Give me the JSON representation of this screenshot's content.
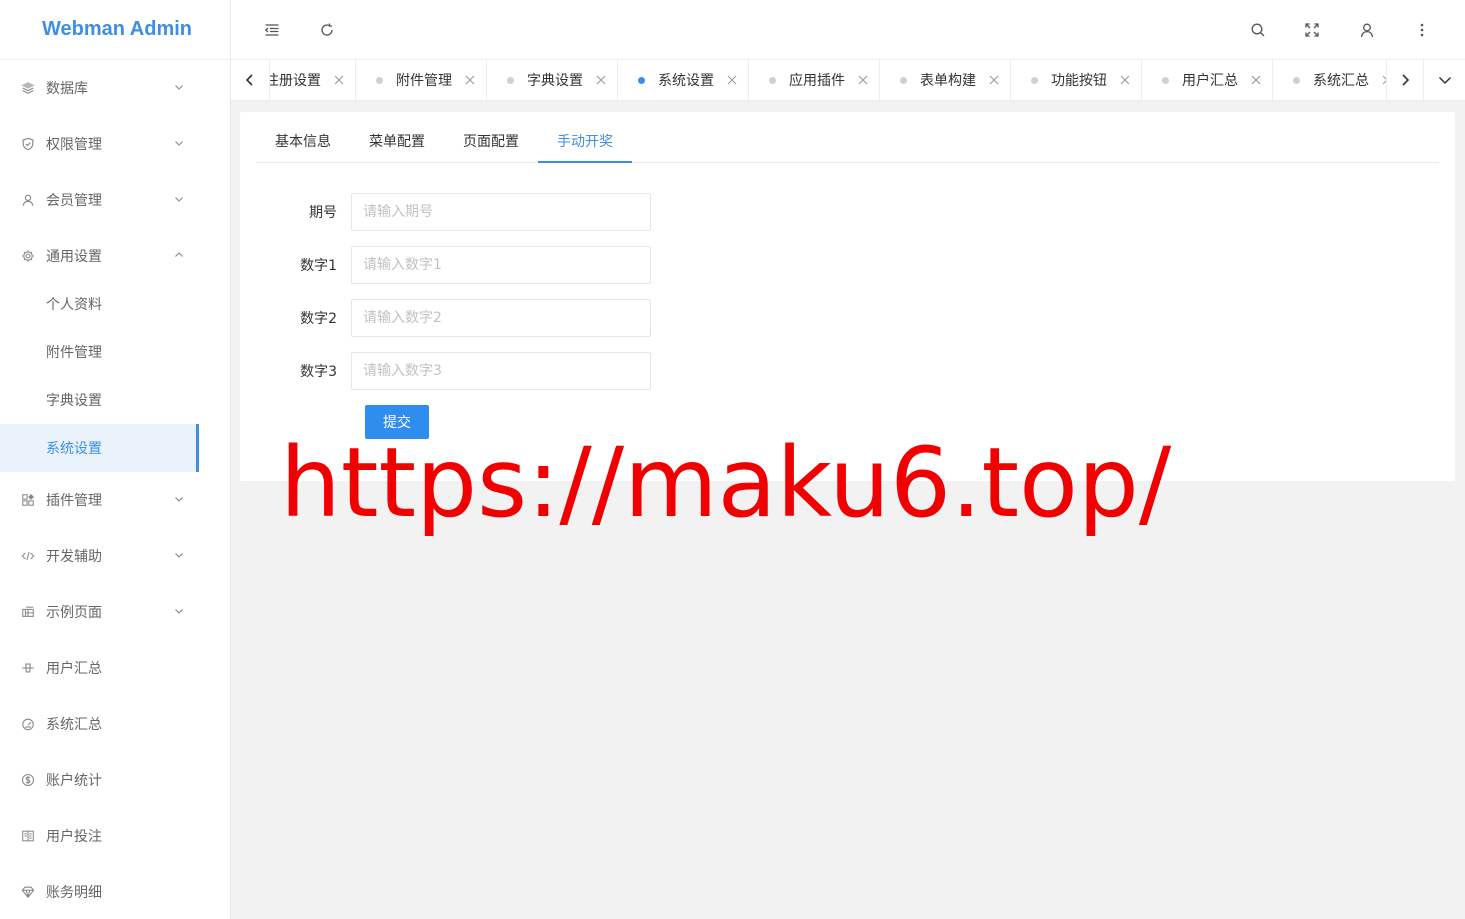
{
  "app": {
    "logo_text": "Webman Admin"
  },
  "sidebar": {
    "items": [
      {
        "label": "数据库",
        "icon": "layers-icon",
        "expandable": true
      },
      {
        "label": "权限管理",
        "icon": "shield-icon",
        "expandable": true
      },
      {
        "label": "会员管理",
        "icon": "user-icon",
        "expandable": true
      },
      {
        "label": "通用设置",
        "icon": "gear-icon",
        "expandable": true,
        "expanded": true
      },
      {
        "label": "插件管理",
        "icon": "apps-icon",
        "expandable": true
      },
      {
        "label": "开发辅助",
        "icon": "code-icon",
        "expandable": true
      },
      {
        "label": "示例页面",
        "icon": "template-icon",
        "expandable": true
      },
      {
        "label": "用户汇总",
        "icon": "commit-icon",
        "expandable": false
      },
      {
        "label": "系统汇总",
        "icon": "gauge-icon",
        "expandable": false
      },
      {
        "label": "账户统计",
        "icon": "dollar-icon",
        "expandable": false
      },
      {
        "label": "用户投注",
        "icon": "read-icon",
        "expandable": false
      },
      {
        "label": "账务明细",
        "icon": "diamond-icon",
        "expandable": false
      }
    ],
    "sub_items": [
      {
        "label": "个人资料",
        "active": false
      },
      {
        "label": "附件管理",
        "active": false
      },
      {
        "label": "字典设置",
        "active": false
      },
      {
        "label": "系统设置",
        "active": true
      }
    ]
  },
  "header": {
    "icons": [
      "collapse-menu-icon",
      "refresh-icon",
      "search-icon",
      "fullscreen-icon",
      "user-icon",
      "more-icon"
    ]
  },
  "tabs": [
    {
      "label": "注册设置",
      "active": false
    },
    {
      "label": "附件管理",
      "active": false
    },
    {
      "label": "字典设置",
      "active": false
    },
    {
      "label": "系统设置",
      "active": true
    },
    {
      "label": "应用插件",
      "active": false
    },
    {
      "label": "表单构建",
      "active": false
    },
    {
      "label": "功能按钮",
      "active": false
    },
    {
      "label": "用户汇总",
      "active": false
    },
    {
      "label": "系统汇总",
      "active": false
    }
  ],
  "content_tabs": [
    {
      "label": "基本信息",
      "active": false
    },
    {
      "label": "菜单配置",
      "active": false
    },
    {
      "label": "页面配置",
      "active": false
    },
    {
      "label": "手动开奖",
      "active": true
    }
  ],
  "form": {
    "fields": [
      {
        "label": "期号",
        "placeholder": "请输入期号",
        "value": ""
      },
      {
        "label": "数字1",
        "placeholder": "请输入数字1",
        "value": ""
      },
      {
        "label": "数字2",
        "placeholder": "请输入数字2",
        "value": ""
      },
      {
        "label": "数字3",
        "placeholder": "请输入数字3",
        "value": ""
      }
    ],
    "submit_label": "提交"
  },
  "watermark": "https://maku6.top/",
  "colors": {
    "accent": "#3d8ee4",
    "button": "#2f8ded",
    "watermark": "#f00000",
    "background": "#f2f2f2"
  }
}
